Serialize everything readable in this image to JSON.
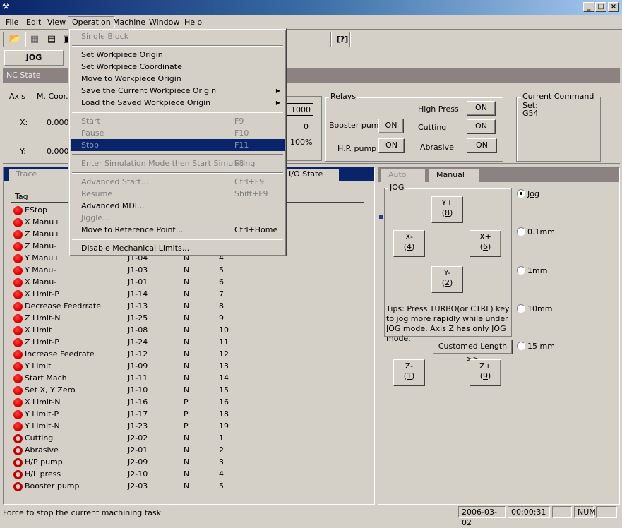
{
  "window": {
    "title": "",
    "min": "_",
    "max": "□",
    "close": "×"
  },
  "menubar": [
    "File",
    "Edit",
    "View",
    "Operation",
    "Machine",
    "Window",
    "Help"
  ],
  "mode_button": "JOG",
  "nc_state": {
    "header": "NC State",
    "axis_label": "Axis",
    "coord_label": "M. Coor..",
    "x_label": "X:",
    "x_value": "0.000",
    "y_label": "Y:",
    "y_value": "0.000",
    "feed_value": "1000",
    "speed_value": "0",
    "override_value": "100%"
  },
  "relays": {
    "label": "Relays",
    "items": [
      {
        "label": "High Press",
        "state": "ON"
      },
      {
        "label": "Booster pump",
        "state": "ON"
      },
      {
        "label": "Cutting",
        "state": "ON"
      },
      {
        "label": "H.P. pump",
        "state": "ON"
      },
      {
        "label": "Abrasive",
        "state": "ON"
      }
    ]
  },
  "command_set": {
    "label": "Current Command Set:",
    "value": "G54"
  },
  "left_tabs": [
    "Trace",
    "I/O State"
  ],
  "io_list": {
    "header": "Tag",
    "rows": [
      {
        "tag": "EStop",
        "pin": "",
        "type": "",
        "num": "",
        "on": true
      },
      {
        "tag": "X Manu+",
        "pin": "",
        "type": "",
        "num": "",
        "on": true
      },
      {
        "tag": "Z Manu+",
        "pin": "",
        "type": "",
        "num": "",
        "on": true
      },
      {
        "tag": "Z Manu-",
        "pin": "",
        "type": "",
        "num": "",
        "on": true
      },
      {
        "tag": "Y Manu+",
        "pin": "J1-04",
        "type": "N",
        "num": "4",
        "on": true
      },
      {
        "tag": "Y Manu-",
        "pin": "J1-03",
        "type": "N",
        "num": "5",
        "on": true
      },
      {
        "tag": "X Manu-",
        "pin": "J1-01",
        "type": "N",
        "num": "6",
        "on": true
      },
      {
        "tag": "X Limit-P",
        "pin": "J1-14",
        "type": "N",
        "num": "7",
        "on": true
      },
      {
        "tag": "Decrease Feedrrate",
        "pin": "J1-13",
        "type": "N",
        "num": "8",
        "on": true
      },
      {
        "tag": "Z Limit-N",
        "pin": "J1-25",
        "type": "N",
        "num": "9",
        "on": true
      },
      {
        "tag": "X Limit",
        "pin": "J1-08",
        "type": "N",
        "num": "10",
        "on": true
      },
      {
        "tag": "Z Limit-P",
        "pin": "J1-24",
        "type": "N",
        "num": "11",
        "on": true
      },
      {
        "tag": "Increase Feedrate",
        "pin": "J1-12",
        "type": "N",
        "num": "12",
        "on": true
      },
      {
        "tag": "Y Limit",
        "pin": "J1-09",
        "type": "N",
        "num": "13",
        "on": true
      },
      {
        "tag": "Start Mach",
        "pin": "J1-11",
        "type": "N",
        "num": "14",
        "on": true
      },
      {
        "tag": "Set X, Y Zero",
        "pin": "J1-10",
        "type": "N",
        "num": "15",
        "on": true
      },
      {
        "tag": "X Limit-N",
        "pin": "J1-16",
        "type": "P",
        "num": "16",
        "on": true
      },
      {
        "tag": "Y Limit-P",
        "pin": "J1-17",
        "type": "P",
        "num": "18",
        "on": true
      },
      {
        "tag": "Y Limit-N",
        "pin": "J1-23",
        "type": "P",
        "num": "19",
        "on": true
      },
      {
        "tag": "Cutting",
        "pin": "J2-02",
        "type": "N",
        "num": "1",
        "on": false
      },
      {
        "tag": "Abrasive",
        "pin": "J2-01",
        "type": "N",
        "num": "2",
        "on": false
      },
      {
        "tag": "H/P pump",
        "pin": "J2-09",
        "type": "N",
        "num": "3",
        "on": false
      },
      {
        "tag": "H/L press",
        "pin": "J2-10",
        "type": "N",
        "num": "4",
        "on": false
      },
      {
        "tag": "Booster pump",
        "pin": "J2-03",
        "type": "N",
        "num": "5",
        "on": false
      }
    ]
  },
  "right_tabs": [
    "Auto",
    "Manual"
  ],
  "jog": {
    "group_label": "JOG",
    "y_plus": {
      "label": "Y+",
      "key": "8"
    },
    "x_minus": {
      "label": "X-",
      "key": "4"
    },
    "x_plus": {
      "label": "X+",
      "key": "6"
    },
    "y_minus": {
      "label": "Y-",
      "key": "2"
    },
    "tips": "Tips: Press TURBO(or CTRL) key to jog more rapidly while under JOG mode. Axis Z has only JOG mode.",
    "custom_length": "Customed Length  >>",
    "z_minus": {
      "label": "Z-",
      "key": "1"
    },
    "z_plus": {
      "label": "Z+",
      "key": "9"
    },
    "step_options": [
      {
        "label": "Jog",
        "checked": true
      },
      {
        "label": "0.1mm",
        "checked": false
      },
      {
        "label": "1mm",
        "checked": false
      },
      {
        "label": "10mm",
        "checked": false
      },
      {
        "label": "15  mm",
        "checked": false
      }
    ]
  },
  "operation_menu": [
    {
      "label": "Single Block",
      "shortcut": "",
      "disabled": true
    },
    {
      "sep": true
    },
    {
      "label": "Set Workpiece Origin",
      "shortcut": "",
      "disabled": false
    },
    {
      "label": "Set Workpiece Coordinate",
      "shortcut": "",
      "disabled": false
    },
    {
      "label": "Move to Workpiece Origin",
      "shortcut": "",
      "disabled": false
    },
    {
      "label": "Save the Current Workpiece Origin",
      "shortcut": "",
      "disabled": false,
      "submenu": true
    },
    {
      "label": "Load the Saved Workpiece Origin",
      "shortcut": "",
      "disabled": false,
      "submenu": true
    },
    {
      "sep": true
    },
    {
      "label": "Start",
      "shortcut": "F9",
      "disabled": true
    },
    {
      "label": "Pause",
      "shortcut": "F10",
      "disabled": true
    },
    {
      "label": "Stop",
      "shortcut": "F11",
      "disabled": true,
      "highlighted": true
    },
    {
      "sep": true
    },
    {
      "label": "Enter Simulation Mode then Start Simulating",
      "shortcut": "F8",
      "disabled": true
    },
    {
      "sep": true
    },
    {
      "label": "Advanced Start...",
      "shortcut": "Ctrl+F9",
      "disabled": true
    },
    {
      "label": "Resume",
      "shortcut": "Shift+F9",
      "disabled": true
    },
    {
      "label": "Advanced MDI...",
      "shortcut": "",
      "disabled": false
    },
    {
      "label": "Jiggle...",
      "shortcut": "",
      "disabled": true
    },
    {
      "label": "Move to Reference Point...",
      "shortcut": "Ctrl+Home",
      "disabled": false
    },
    {
      "sep": true
    },
    {
      "label": "Disable Mechanical Limits...",
      "shortcut": "",
      "disabled": false
    }
  ],
  "statusbar": {
    "message": "Force to stop the current machining task",
    "date": "2006-03-02",
    "time": "00:00:31",
    "cap": "",
    "num": "NUM",
    "scrl": ""
  }
}
